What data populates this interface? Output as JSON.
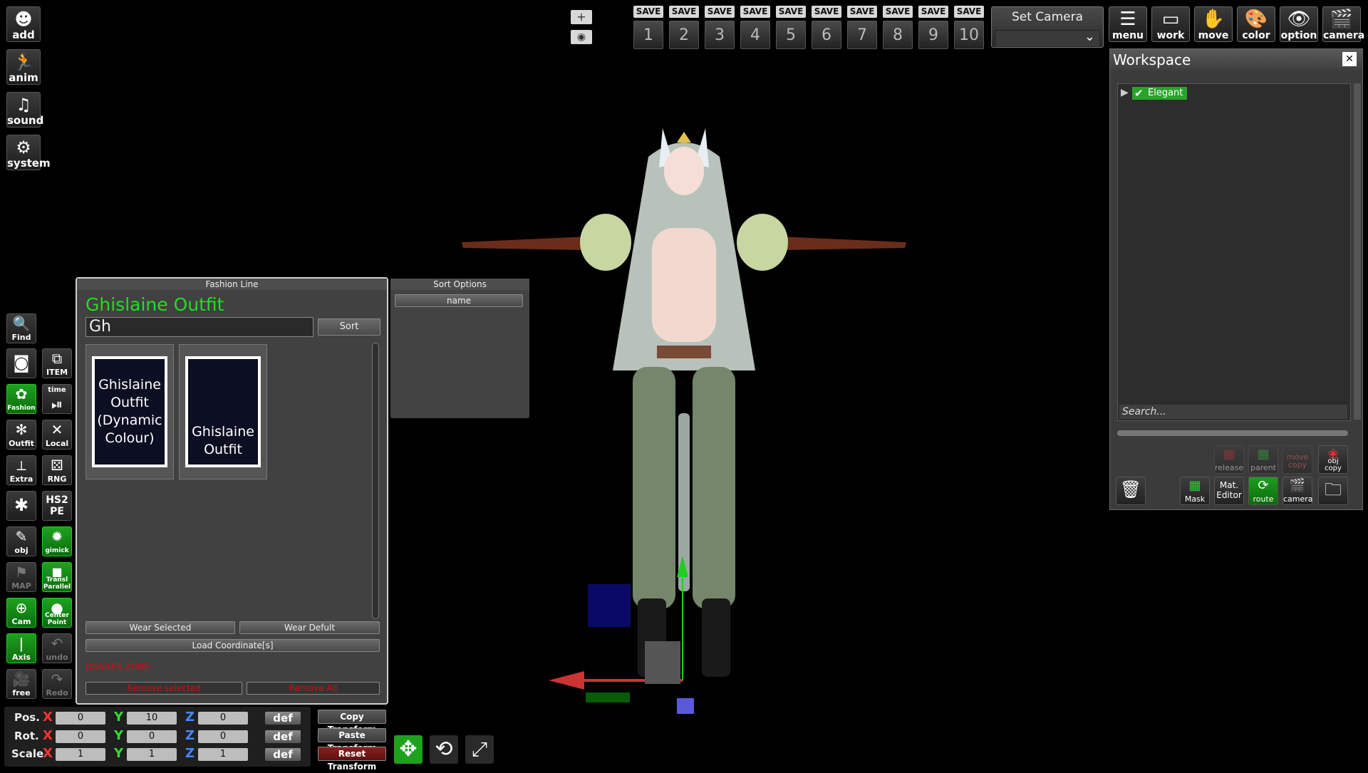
{
  "left_toolbar": {
    "add": "add",
    "anim": "anim",
    "sound": "sound",
    "system": "system",
    "find": "Find",
    "item": "ITEM",
    "fashion": "Fashion",
    "time": "time",
    "outfit": "Outfit",
    "local": "Local",
    "extra": "Extra",
    "rng": "RNG",
    "hs2pe": "HS2\nPE",
    "obj": "obj",
    "gimick": "gimick",
    "map": "MAP",
    "transl": "Transl\nParallel",
    "cam": "Cam",
    "center_point": "Center\nPoint",
    "axis": "Axis",
    "undo": "undo",
    "free": "free",
    "redo": "Redo"
  },
  "viewport": {
    "plus": "+",
    "eye": "◉"
  },
  "save_slots": {
    "label": "SAVE",
    "numbers": [
      "1",
      "2",
      "3",
      "4",
      "5",
      "6",
      "7",
      "8",
      "9",
      "10"
    ]
  },
  "camera": {
    "title": "Set Camera"
  },
  "top_buttons": {
    "menu": "menu",
    "work": "work",
    "move": "move",
    "color": "color",
    "option": "option",
    "camera": "camera"
  },
  "workspace": {
    "title": "Workspace",
    "close": "✕",
    "tree_item": "Elegant",
    "search_placeholder": "Search...",
    "release": "release",
    "parent": "parent",
    "move_copy": "move\ncopy",
    "obj_copy": "obj\ncopy",
    "mask": "Mask",
    "mat_editor": "Mat.\nEditor",
    "route": "route",
    "camera": "camera"
  },
  "fashion_line": {
    "title": "Fashion Line",
    "selected_name": "Ghislaine Outfit",
    "search_value": "Gh",
    "sort_button": "Sort",
    "items": [
      {
        "label": "Ghislaine Outfit (Dynamic Colour)"
      },
      {
        "label": "Ghislaine Outfit"
      }
    ],
    "wear_selected": "Wear Selected",
    "wear_default": "Wear Defult",
    "load_coordinates": "Load Coordinate[s]",
    "danger_zone": "DANGER ZONE",
    "remove_selected": "Remove selected",
    "remove_all": "Remove All"
  },
  "sort_options": {
    "title": "Sort Options",
    "name": "name"
  },
  "transform": {
    "pos_label": "Pos.",
    "rot_label": "Rot.",
    "scale_label": "Scale",
    "x": "X",
    "y": "Y",
    "z": "Z",
    "pos": [
      "0",
      "10",
      "0"
    ],
    "rot": [
      "0",
      "0",
      "0"
    ],
    "scale": [
      "1",
      "1",
      "1"
    ],
    "def": "def",
    "copy_transform": "Copy Transform",
    "paste_transform": "Paste Transform",
    "reset_transform": "Reset Transform"
  },
  "colors": {
    "accent_green": "#22dd22",
    "danger_red": "#cc1111",
    "axis_x": "#ff3333",
    "axis_y": "#33dd33",
    "axis_z": "#4488ff"
  }
}
